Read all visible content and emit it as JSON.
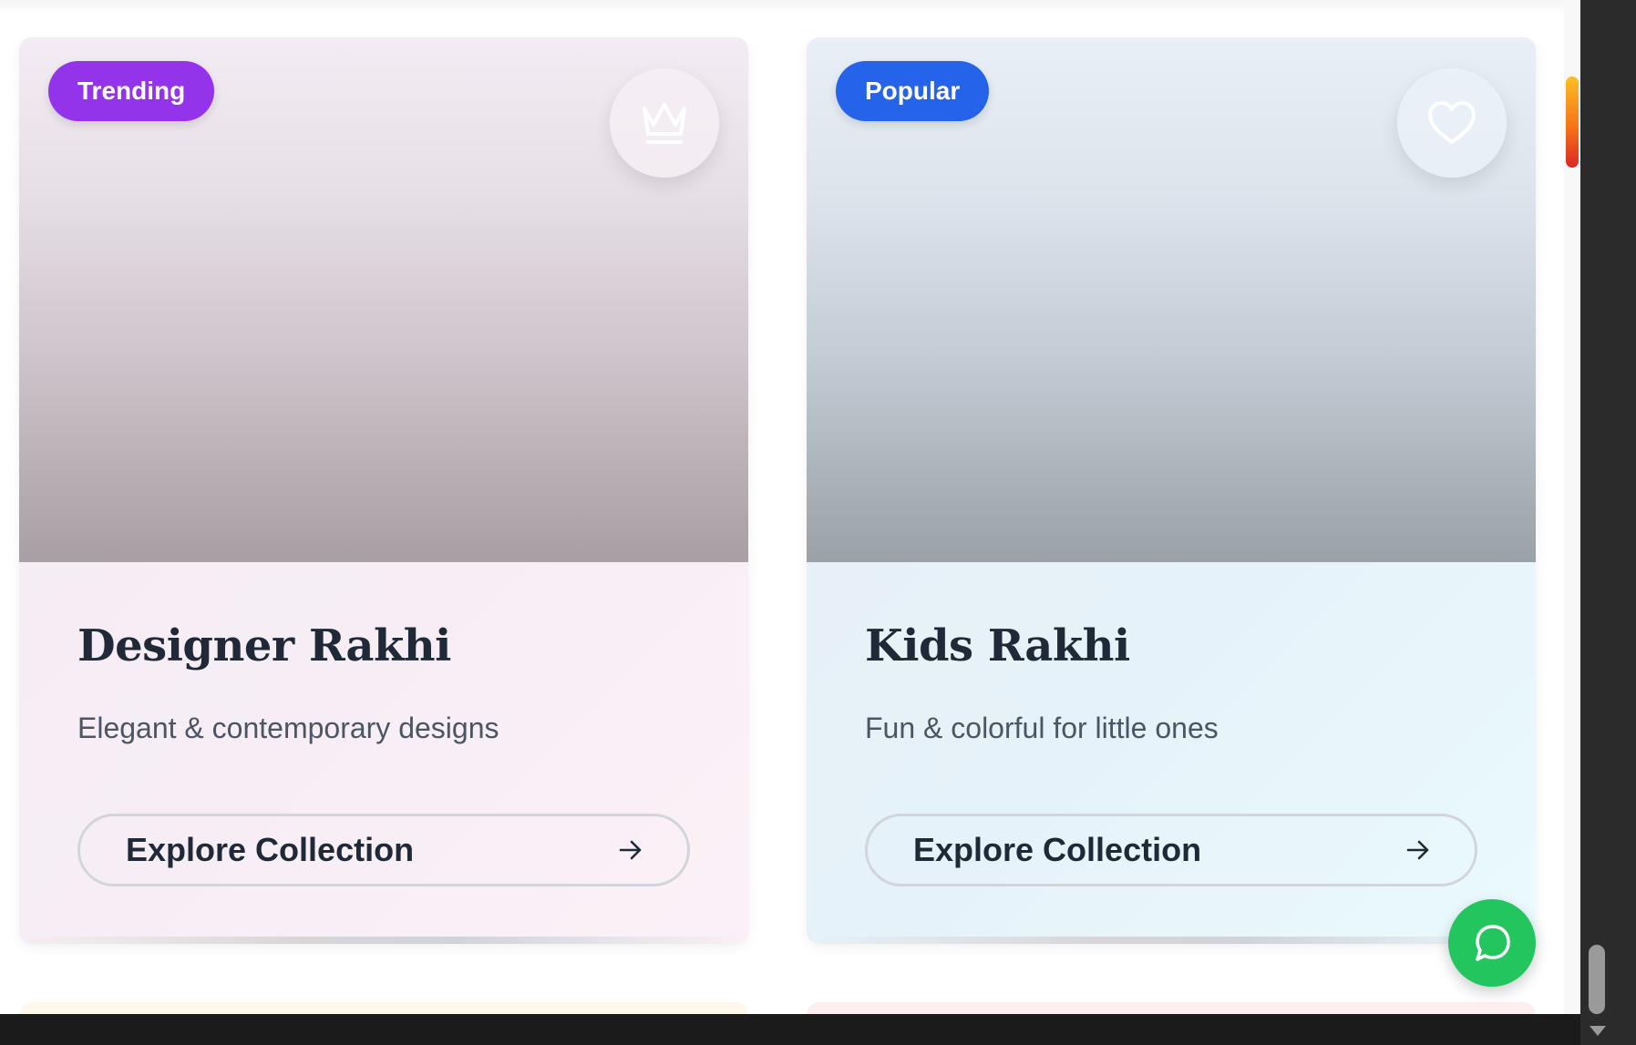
{
  "cards": [
    {
      "badge": "Trending",
      "icon": "crown-icon",
      "title": "Designer Rakhi",
      "description": "Elegant & contemporary designs",
      "button_label": "Explore Collection"
    },
    {
      "badge": "Popular",
      "icon": "heart-icon",
      "title": "Kids Rakhi",
      "description": "Fun & colorful for little ones",
      "button_label": "Explore Collection"
    }
  ],
  "colors": {
    "trending_badge": "#9333ea",
    "popular_badge": "#2563eb",
    "whatsapp": "#22c55e",
    "title_text": "#1f2937",
    "description_text": "#4b5563"
  },
  "floating_action": {
    "icon": "whatsapp-chat-icon"
  }
}
